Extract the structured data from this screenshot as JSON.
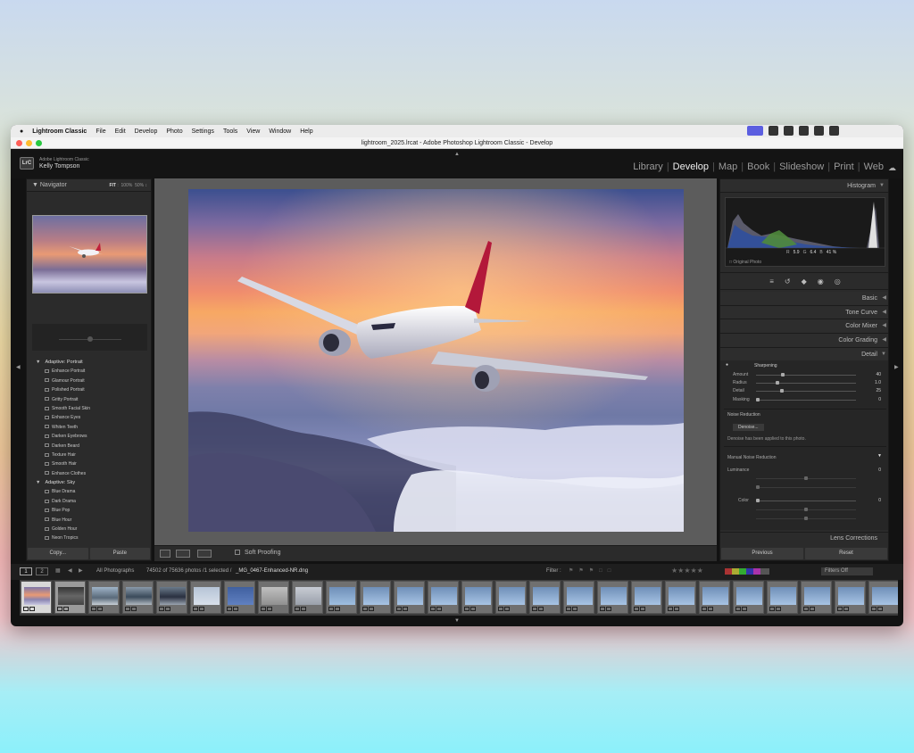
{
  "menubar": {
    "apple": "",
    "app": "Lightroom Classic",
    "items": [
      "File",
      "Edit",
      "Develop",
      "Photo",
      "Settings",
      "Tools",
      "View",
      "Window",
      "Help"
    ]
  },
  "window": {
    "title": "lightroom_2025.lrcat - Adobe Photoshop Lightroom Classic - Develop"
  },
  "identity": {
    "badge": "LrC",
    "product": "Adobe Lightroom Classic",
    "user": "Kelly Tompson"
  },
  "modules": [
    "Library",
    "Develop",
    "Map",
    "Book",
    "Slideshow",
    "Print",
    "Web"
  ],
  "active_module": "Develop",
  "navigator": {
    "title": "Navigator",
    "zoom": [
      "FIT",
      "100%",
      "50%"
    ]
  },
  "presets": {
    "groups": [
      {
        "name": "Adaptive: Portrait",
        "items": [
          "Enhance Portrait",
          "Glamour Portrait",
          "Polished Portrait",
          "Gritty Portrait",
          "Smooth Facial Skin",
          "Enhance Eyes",
          "Whiten Teeth",
          "Darken Eyebrows",
          "Darken Beard",
          "Texture Hair",
          "Smooth Hair",
          "Enhance Clothes"
        ]
      },
      {
        "name": "Adaptive: Sky",
        "items": [
          "Blue Drama",
          "Dark Drama",
          "Blue Pop",
          "Blue Hour",
          "Golden Hour",
          "Neon Tropics"
        ]
      }
    ]
  },
  "left_buttons": {
    "copy": "Copy...",
    "paste": "Paste"
  },
  "toolbar": {
    "soft_proofing": "Soft Proofing"
  },
  "histogram": {
    "title": "Histogram",
    "r_label": "R",
    "r": "5.9",
    "g_label": "G",
    "g": "6.4",
    "b_label": "B",
    "b": "41 %",
    "original_photo": "Original Photo"
  },
  "panels": [
    "Basic",
    "Tone Curve",
    "Color Mixer",
    "Color Grading"
  ],
  "detail": {
    "title": "Detail",
    "sharpening": "Sharpening",
    "rows": [
      {
        "label": "Amount",
        "value": "40",
        "pos": 0.27
      },
      {
        "label": "Radius",
        "value": "1.0",
        "pos": 0.2
      },
      {
        "label": "Detail",
        "value": "25",
        "pos": 0.25
      },
      {
        "label": "Masking",
        "value": "0",
        "pos": 0.0
      }
    ],
    "noise_reduction": "Noise Reduction",
    "denoise_btn": "Denoise...",
    "denoise_msg": "Denoise has been applied to this photo.",
    "manual_nr": "Manual Noise Reduction",
    "luminance": "Luminance",
    "luminance_value": "0",
    "color": "Color",
    "color_value": "0"
  },
  "lens_corrections": "Lens Corrections",
  "right_buttons": {
    "previous": "Previous",
    "reset": "Reset"
  },
  "filmstrip": {
    "view1": "1",
    "view2": "2",
    "source": "All Photographs",
    "count": "74502 of 75636 photos /1 selected /",
    "filename": "_MG_0467-Enhanced-NR.dng",
    "filter_label": "Filter :",
    "filters_off": "Filters Off"
  }
}
